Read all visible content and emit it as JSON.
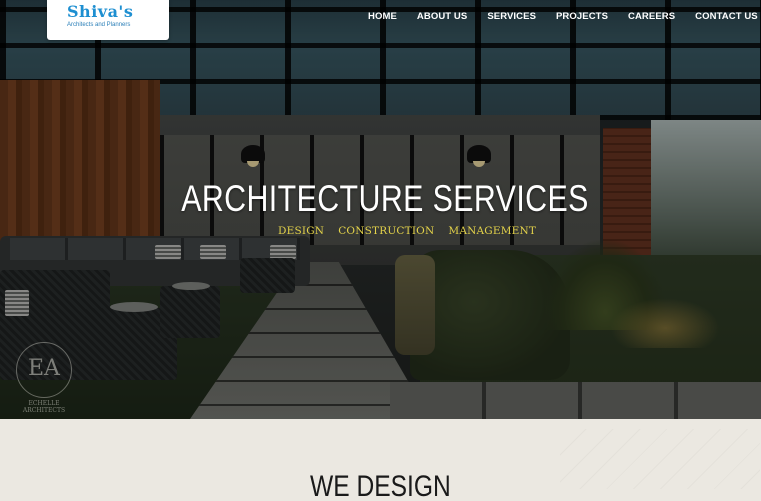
{
  "logo": {
    "name": "Shiva's",
    "tagline": "Architects and Planners"
  },
  "nav": {
    "items": [
      "HOME",
      "ABOUT US",
      "SERVICES",
      "PROJECTS",
      "CAREERS",
      "CONTACT US"
    ]
  },
  "hero": {
    "title": "ARCHITECTURE SERVICES",
    "subtitles": [
      "DESIGN",
      "CONSTRUCTION",
      "MANAGEMENT"
    ]
  },
  "watermark": {
    "monogram": "EA",
    "name_line1": "ECHELLE",
    "name_line2": "ARCHITECTS"
  },
  "section": {
    "title": "WE DESIGN"
  },
  "colors": {
    "logo_blue": "#1e8fd1",
    "subtitle_yellow": "#e3d24a",
    "nav_text": "#ffffff"
  }
}
